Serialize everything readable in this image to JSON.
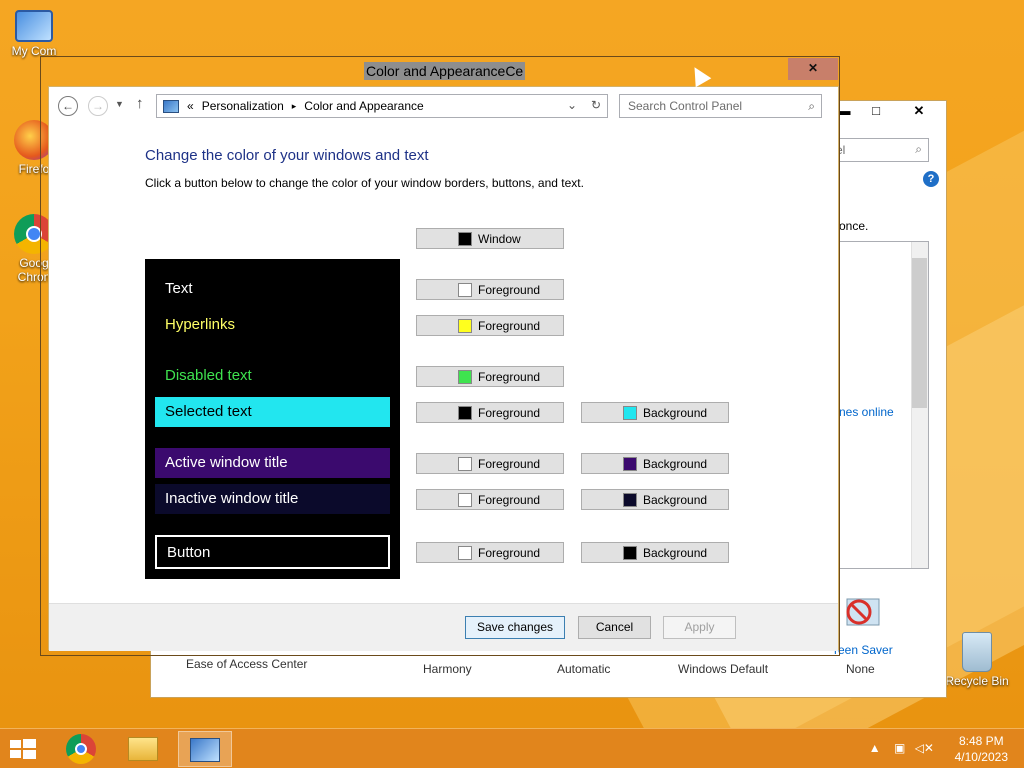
{
  "desktop": {
    "icons": [
      {
        "label": "My Com",
        "name": "my-computer-icon"
      },
      {
        "label": "Firefo",
        "name": "firefox-icon"
      },
      {
        "label": "Goog Chron",
        "name": "chrome-desktop-icon"
      },
      {
        "label": "Recycle Bin",
        "name": "recycle-bin-icon"
      }
    ]
  },
  "back_window": {
    "search_placeholder": "el",
    "once_text": "once.",
    "themes_link": "nes online",
    "bottom": [
      "Ease of Access Center",
      "Harmony",
      "Automatic",
      "Windows Default",
      "None"
    ],
    "screen_saver": "reen Saver",
    "controls": {
      "min": "▬",
      "max": "□",
      "close": "✕"
    }
  },
  "ghost": {
    "title": "Color and AppearanceCe"
  },
  "window": {
    "breadcrumb": [
      "«",
      "Personalization",
      "▸",
      "Color and Appearance"
    ],
    "search_placeholder": "Search Control Panel",
    "heading": "Change the color of your windows and text",
    "description": "Click a button below to change the color of your window borders, buttons, and text.",
    "preview": [
      {
        "label": "Text",
        "fg": "#ffffff",
        "bg": "transparent"
      },
      {
        "label": "Hyperlinks",
        "fg": "#ffff66",
        "bg": "transparent"
      },
      {
        "label": "Disabled text",
        "fg": "#3fe34f",
        "bg": "transparent"
      },
      {
        "label": "Selected text",
        "fg": "#000000",
        "bg": "#22e6ef"
      },
      {
        "label": "Active window title",
        "fg": "#ffffff",
        "bg": "#3b0a6e"
      },
      {
        "label": "Inactive window title",
        "fg": "#ffffff",
        "bg": "#0b0a2b"
      },
      {
        "label": "Button",
        "fg": "#ffffff",
        "bg": "#000000"
      }
    ],
    "color_buttons": {
      "window": {
        "label": "Window",
        "color": "#000000"
      },
      "text_fg": {
        "label": "Foreground",
        "color": "#ffffff"
      },
      "hyperlinks_fg": {
        "label": "Foreground",
        "color": "#ffff1e"
      },
      "disabled_fg": {
        "label": "Foreground",
        "color": "#3fe34f"
      },
      "selected_fg": {
        "label": "Foreground",
        "color": "#000000"
      },
      "selected_bg": {
        "label": "Background",
        "color": "#22e6ef"
      },
      "active_fg": {
        "label": "Foreground",
        "color": "#ffffff"
      },
      "active_bg": {
        "label": "Background",
        "color": "#3b0a6e"
      },
      "inactive_fg": {
        "label": "Foreground",
        "color": "#ffffff"
      },
      "inactive_bg": {
        "label": "Background",
        "color": "#0b0a2b"
      },
      "button_fg": {
        "label": "Foreground",
        "color": "#ffffff"
      },
      "button_bg": {
        "label": "Background",
        "color": "#000000"
      }
    },
    "footer": {
      "save": "Save changes",
      "cancel": "Cancel",
      "apply": "Apply"
    }
  },
  "taskbar": {
    "clock_time": "8:48 PM",
    "clock_date": "4/10/2023"
  }
}
